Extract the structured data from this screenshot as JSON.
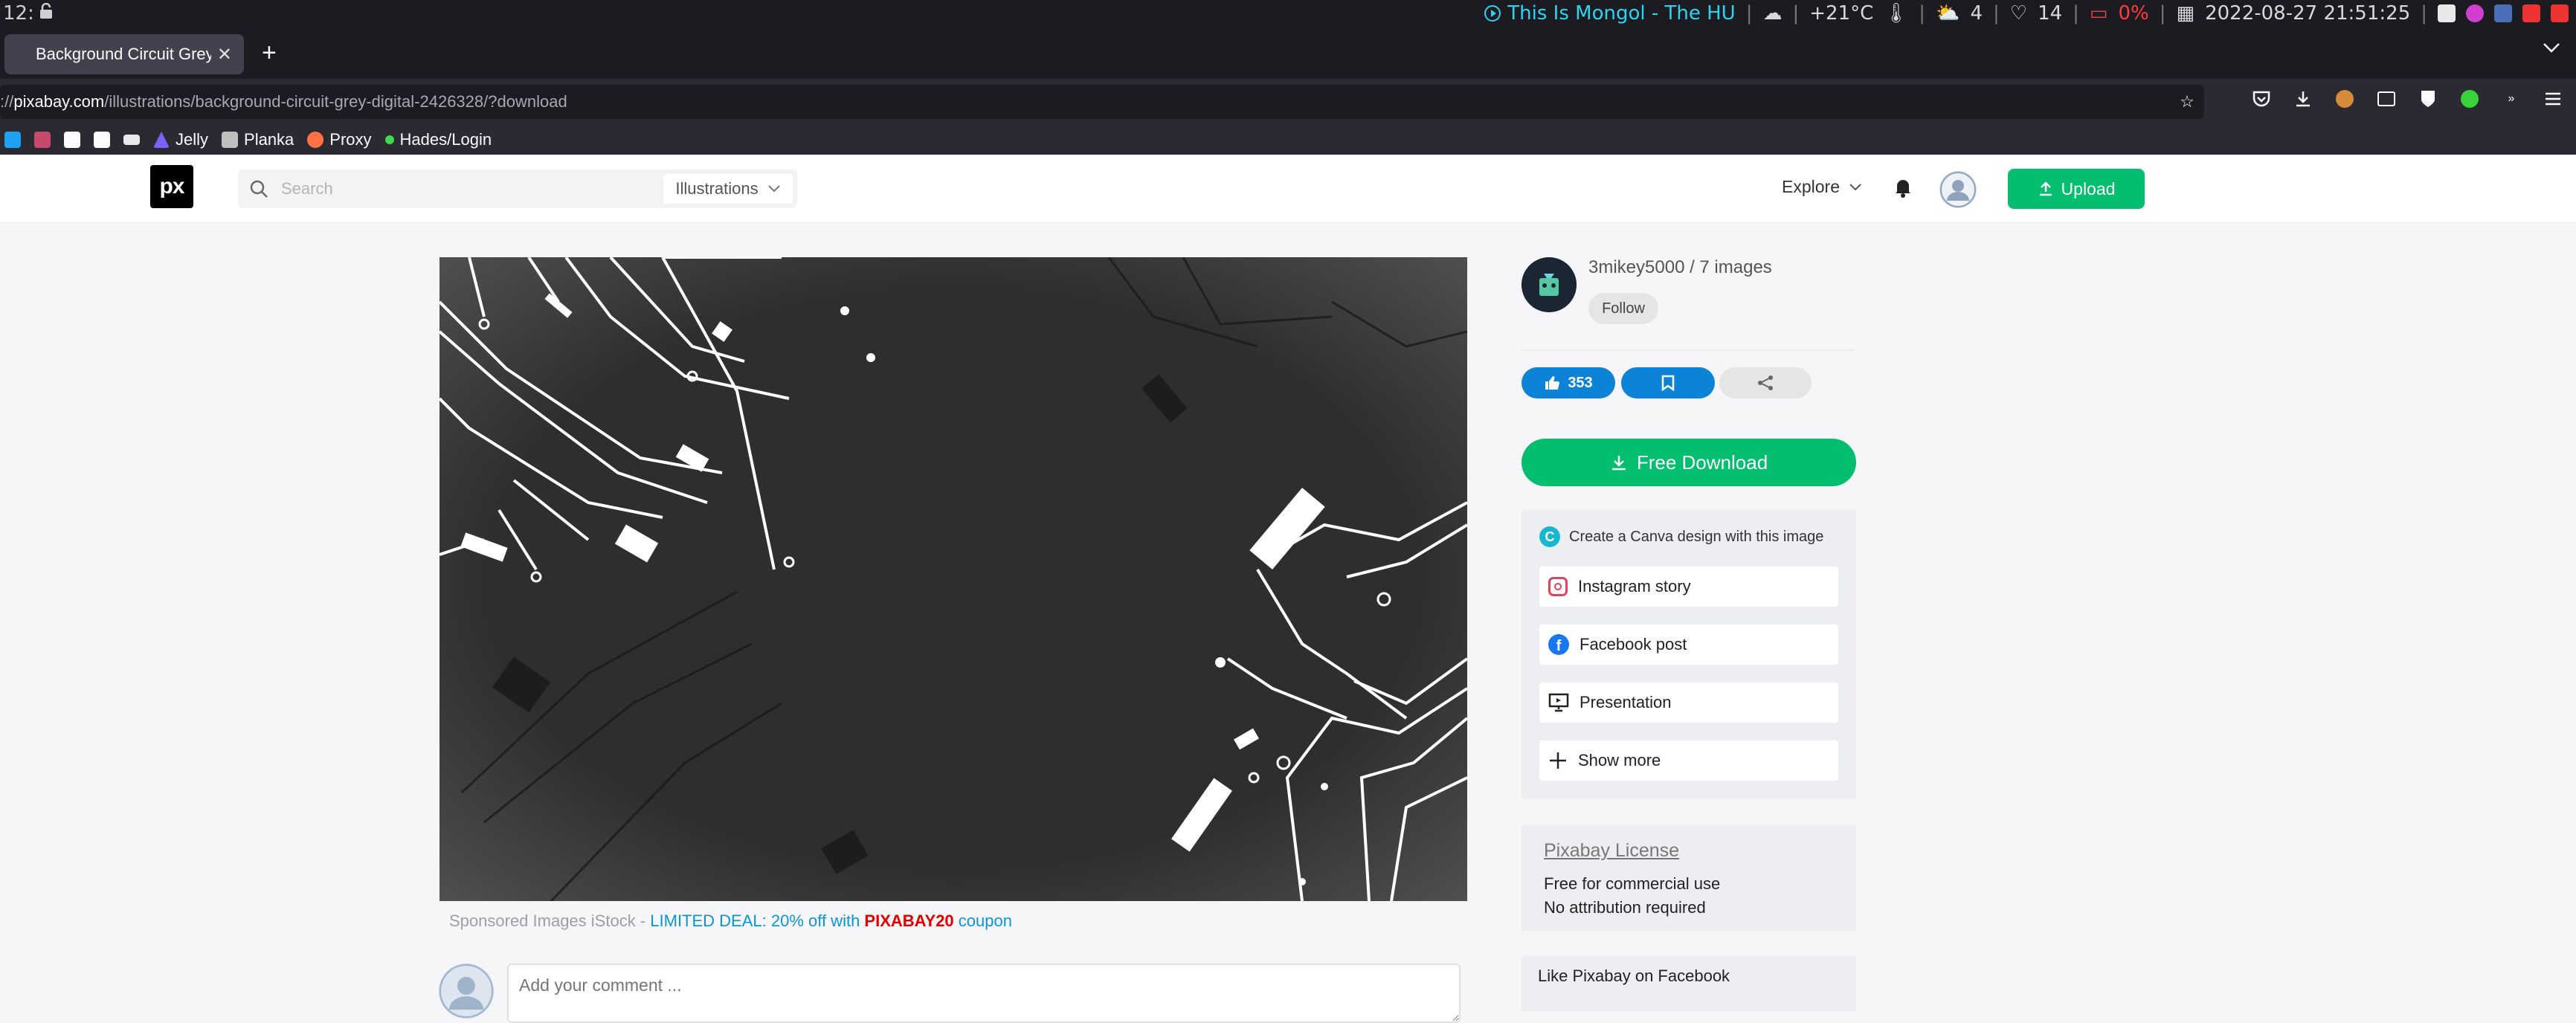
{
  "system_bar": {
    "workspace": "12:",
    "now_playing": "This Is Mongol - The HU",
    "weather": "+21°C",
    "updates": "4",
    "health": "14",
    "battery": "0%",
    "datetime": "2022-08-27 21:51:25"
  },
  "browser": {
    "tab_title": "Background Circuit Grey - Pi",
    "url_host": "pixabay.com",
    "url_prefix": "://",
    "url_path": "/illustrations/background-circuit-grey-digital-2426328/?download",
    "bookmarks": [
      {
        "label": "Jelly",
        "color": "#7b61ff"
      },
      {
        "label": "Planka",
        "color": "#bfbfbf"
      },
      {
        "label": "Proxy",
        "color": "#ff7043"
      },
      {
        "label": "Hades/Login",
        "color": "#3ddc4c"
      }
    ]
  },
  "header": {
    "logo": "px",
    "search_placeholder": "Search",
    "media_type": "Illustrations",
    "explore_label": "Explore",
    "upload_label": "Upload"
  },
  "author": {
    "name_line": "3mikey5000 / 7 images",
    "follow_label": "Follow"
  },
  "actions": {
    "like_count": "353",
    "download_label": "Free Download"
  },
  "canva": {
    "title": "Create a Canva design with this image",
    "items": [
      "Instagram story",
      "Facebook post",
      "Presentation",
      "Show more"
    ]
  },
  "license": {
    "link": "Pixabay License",
    "line1": "Free for commercial use",
    "line2": "No attribution required"
  },
  "facebook": {
    "label": "Like Pixabay on Facebook"
  },
  "sponsored": {
    "prefix": "Sponsored Images iStock",
    "separator": " - ",
    "deal": "LIMITED DEAL: 20% off with ",
    "code": "PIXABAY20",
    "suffix": " coupon"
  },
  "comment": {
    "placeholder": "Add your comment ..."
  },
  "colors": {
    "brand_green": "#02be6e",
    "action_blue": "#0c83d6",
    "deal_blue": "#0d94d8",
    "coupon_red": "#e00000"
  }
}
